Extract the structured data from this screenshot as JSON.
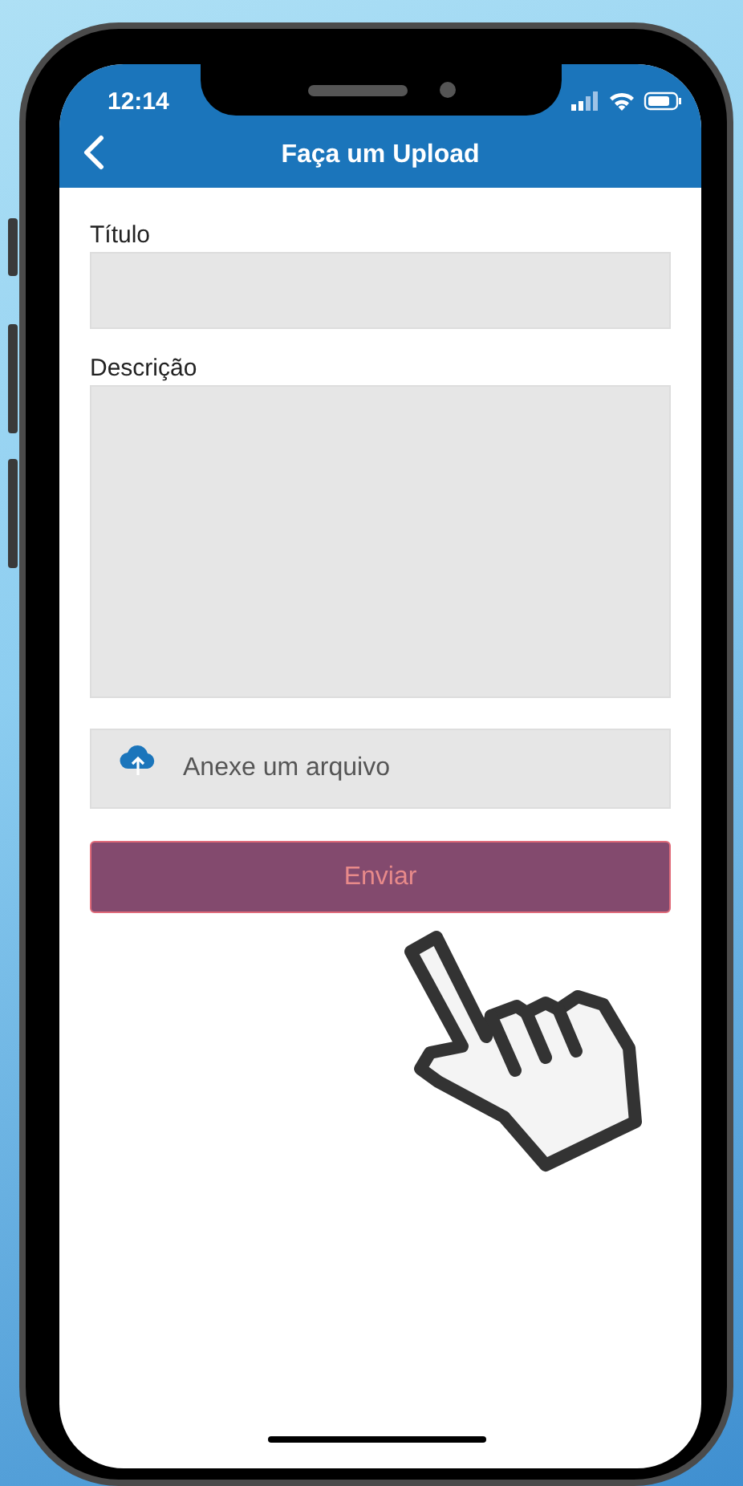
{
  "status_bar": {
    "time": "12:14"
  },
  "header": {
    "title": "Faça um Upload"
  },
  "fields": [
    {
      "kind": "text",
      "label": "Título"
    },
    {
      "kind": "textarea",
      "label": "Descrição"
    }
  ],
  "attachment": {
    "placeholder": "Anexe um arquivo"
  },
  "submit_button": {
    "label": "Enviar"
  }
}
